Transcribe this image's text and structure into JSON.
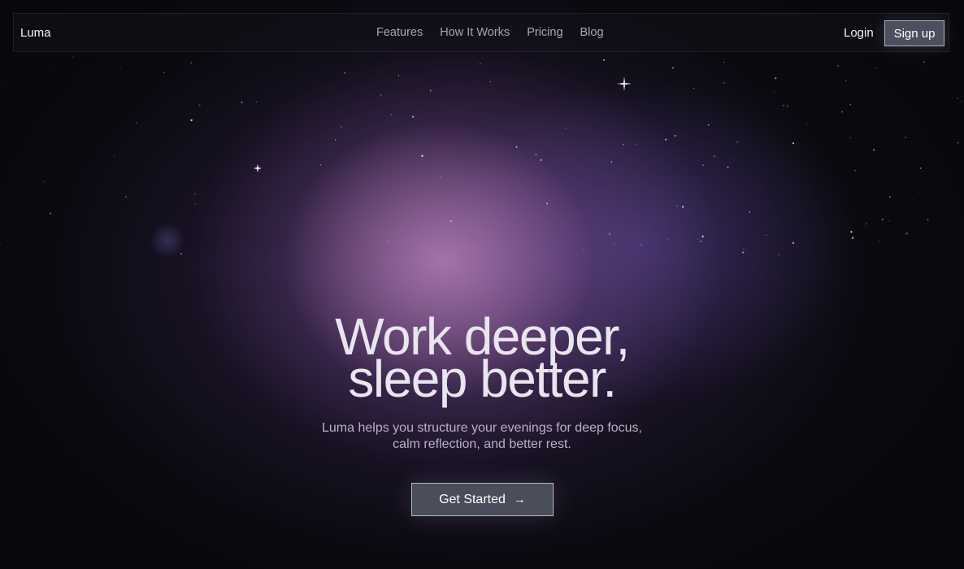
{
  "nav": {
    "brand": "Luma",
    "links": [
      "Features",
      "How It Works",
      "Pricing",
      "Blog"
    ],
    "login_label": "Login",
    "signup_label": "Sign up"
  },
  "hero": {
    "title_line1": "Work deeper,",
    "title_line2": "sleep better.",
    "subtitle": "Luma helps you structure your evenings for deep focus, calm reflection, and better rest.",
    "cta_label": "Get Started",
    "cta_icon": "arrow-right-icon"
  },
  "colors": {
    "background": "#0b0a10",
    "glow_pink": "#d79bcd",
    "glow_purple": "#965faf",
    "glow_indigo": "#5f4ba5",
    "button_fill": "#4a4d5a"
  }
}
